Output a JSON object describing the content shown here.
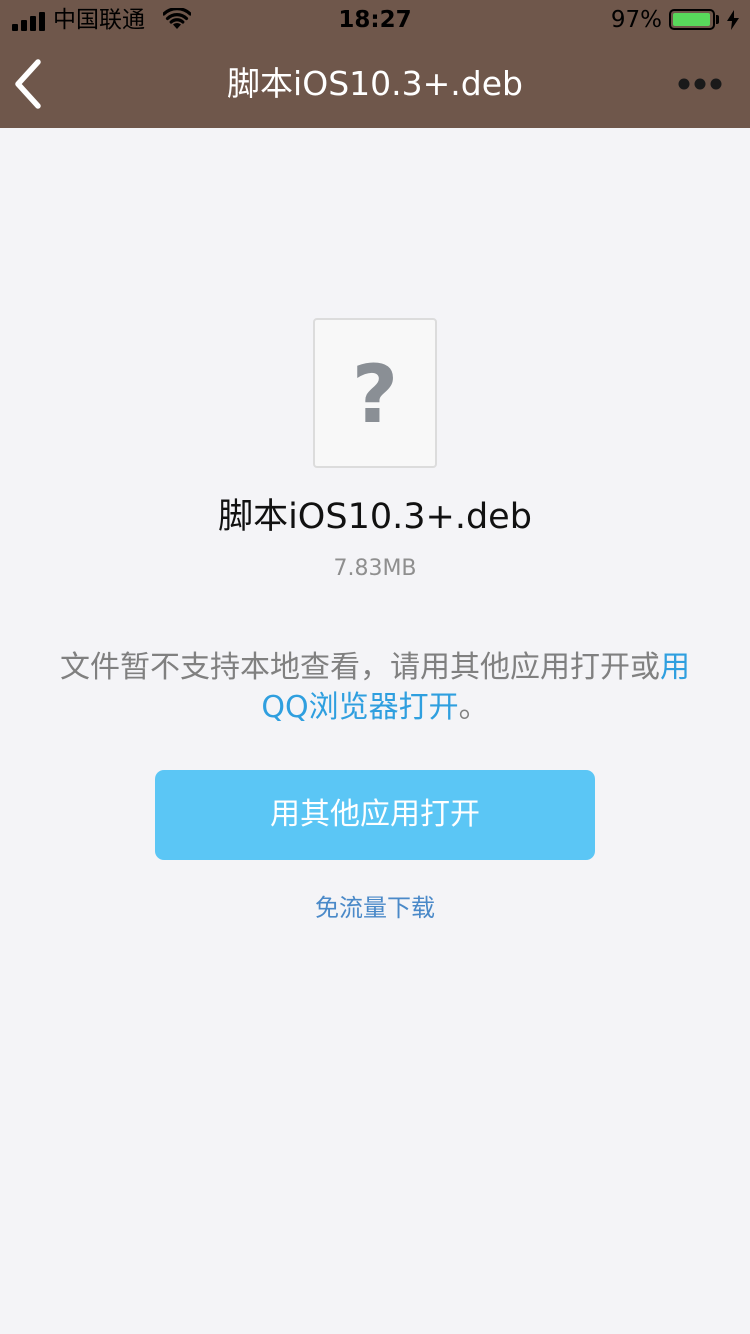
{
  "status_bar": {
    "carrier": "中国联通",
    "time": "18:27",
    "battery_percent": "97%",
    "battery_level": 0.97,
    "icons": [
      "signal-icon",
      "wifi-icon",
      "battery-icon",
      "charging-bolt-icon"
    ]
  },
  "navbar": {
    "title": "脚本iOS10.3+.deb",
    "back_icon": "chevron-left-icon",
    "more_icon": "more-dots-icon"
  },
  "file": {
    "icon": "unknown-file-icon",
    "icon_glyph": "?",
    "name": "脚本iOS10.3+.deb",
    "size": "7.83MB"
  },
  "notice": {
    "text_before": "文件暂不支持本地查看，请用其他应用打开或",
    "link_text": "用QQ浏览器打开",
    "text_after": "。"
  },
  "actions": {
    "open_with_other_app": "用其他应用打开",
    "free_download": "免流量下载"
  },
  "colors": {
    "header_bg": "#6f574b",
    "page_bg": "#f4f4f7",
    "primary_button": "#5bc6f5",
    "link": "#2f9fdf",
    "secondary_link": "#4a89c8",
    "battery_fill": "#58d85b"
  }
}
